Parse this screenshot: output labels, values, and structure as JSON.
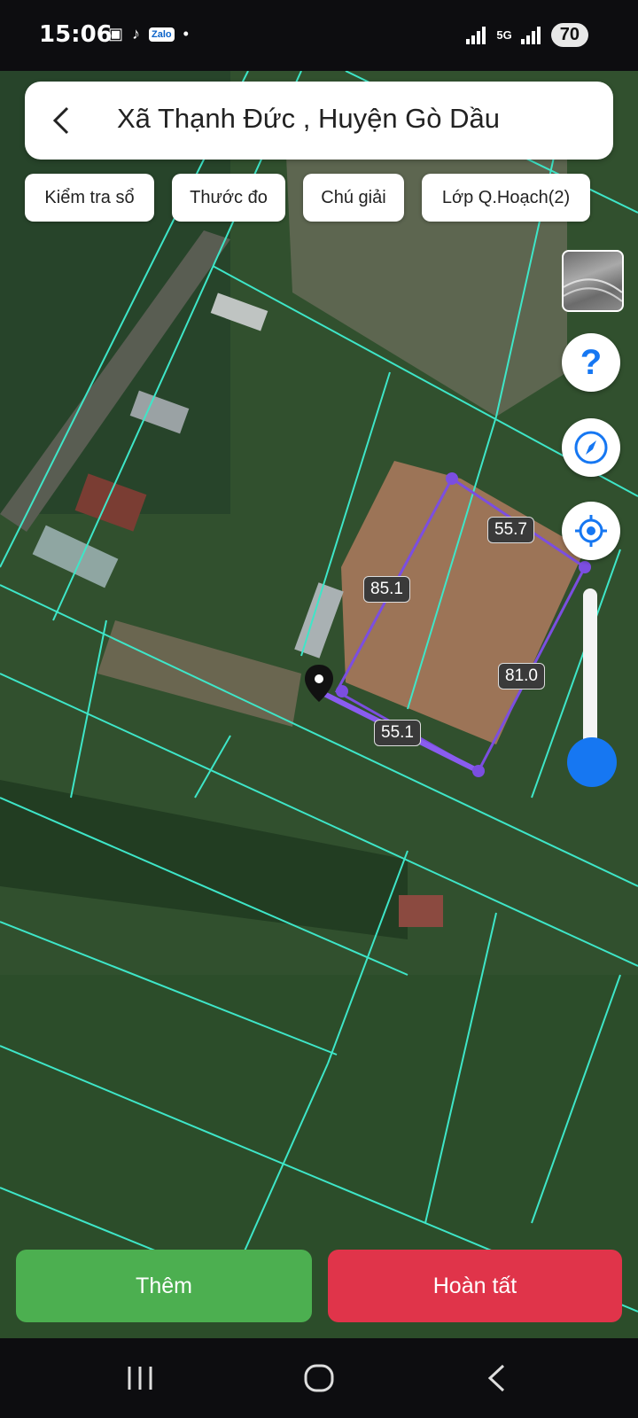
{
  "status_bar": {
    "time": "15:06",
    "network": "5G",
    "battery": "70"
  },
  "search": {
    "title": "Xã Thạnh Đức , Huyện Gò Dầu"
  },
  "chips": [
    {
      "label": "Kiểm tra sổ"
    },
    {
      "label": "Thước đo"
    },
    {
      "label": "Chú giải"
    },
    {
      "label": "Lớp Q.Hoạch(2)"
    }
  ],
  "side_buttons": {
    "help_label": "?"
  },
  "measurements": {
    "top": "55.7",
    "left": "85.1",
    "right": "81.0",
    "bottom": "55.1"
  },
  "actions": {
    "add_label": "Thêm",
    "finish_label": "Hoàn tất"
  },
  "colors": {
    "add": "#4caf50",
    "finish": "#e0344a",
    "accent": "#1677f2",
    "polygon": "#7b4ee0",
    "parcel_lines": "#3ee6c8"
  }
}
